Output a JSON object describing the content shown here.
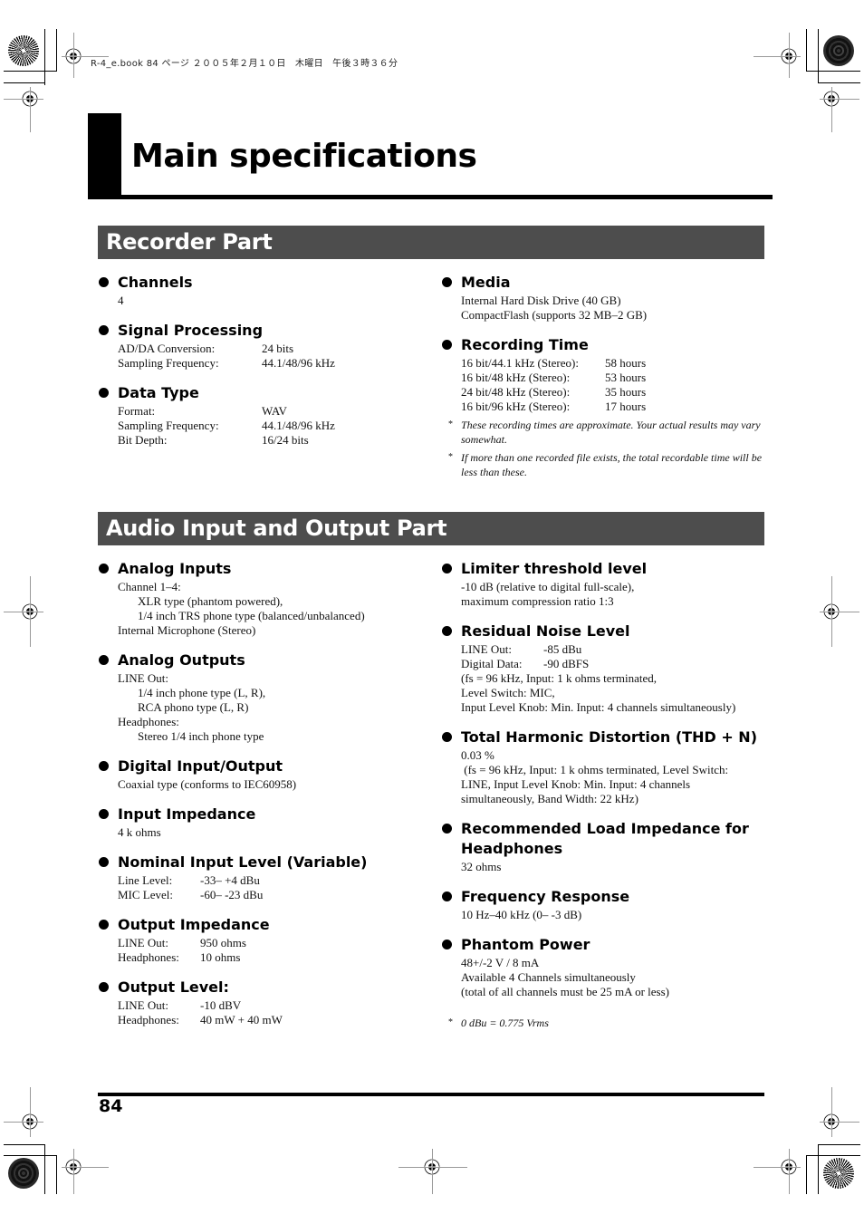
{
  "book_header": "R-4_e.book  84 ページ  ２００５年２月１０日　木曜日　午後３時３６分",
  "page_title": "Main specifications",
  "sections": {
    "recorder": {
      "title": "Recorder Part",
      "left": [
        {
          "heading": "Channels",
          "lines": [
            "4"
          ]
        },
        {
          "heading": "Signal Processing",
          "rows": [
            {
              "k": "AD/DA Conversion:",
              "v": "24 bits"
            },
            {
              "k": "Sampling Frequency:",
              "v": "44.1/48/96 kHz"
            }
          ]
        },
        {
          "heading": "Data Type",
          "rows": [
            {
              "k": "Format:",
              "v": "WAV"
            },
            {
              "k": "Sampling Frequency:",
              "v": "44.1/48/96 kHz"
            },
            {
              "k": "Bit Depth:",
              "v": "16/24 bits"
            }
          ]
        }
      ],
      "right": [
        {
          "heading": "Media",
          "lines": [
            "Internal Hard Disk Drive (40 GB)",
            "CompactFlash (supports 32 MB–2 GB)"
          ]
        },
        {
          "heading": "Recording Time",
          "rows": [
            {
              "k": "16 bit/44.1 kHz (Stereo):",
              "v": "58 hours"
            },
            {
              "k": "16 bit/48 kHz (Stereo):",
              "v": "53 hours"
            },
            {
              "k": "24 bit/48 kHz (Stereo):",
              "v": "35 hours"
            },
            {
              "k": "16 bit/96 kHz (Stereo):",
              "v": "17 hours"
            }
          ],
          "notes": [
            "These recording times are approximate. Your actual results may vary somewhat.",
            "If more than one recorded file exists, the total recordable time will be less than these."
          ]
        }
      ]
    },
    "audio": {
      "title": "Audio Input and Output Part",
      "left": [
        {
          "heading": "Analog Inputs",
          "lines": [
            "Channel 1–4:",
            ">XLR type (phantom powered),",
            ">1/4 inch TRS phone type (balanced/unbalanced)",
            "Internal Microphone (Stereo)"
          ]
        },
        {
          "heading": "Analog Outputs",
          "lines": [
            "LINE Out:",
            ">1/4 inch phone type (L, R),",
            ">RCA phono type (L, R)",
            "Headphones:",
            ">Stereo 1/4 inch phone type"
          ]
        },
        {
          "heading": "Digital Input/Output",
          "lines": [
            "Coaxial type (conforms to IEC60958)"
          ]
        },
        {
          "heading": "Input Impedance",
          "lines": [
            "4 k ohms"
          ]
        },
        {
          "heading": "Nominal Input Level (Variable)",
          "rows": [
            {
              "k": "Line Level:",
              "v": "-33– +4 dBu"
            },
            {
              "k": "MIC Level:",
              "v": "-60– -23 dBu"
            }
          ]
        },
        {
          "heading": "Output Impedance",
          "rows": [
            {
              "k": "LINE Out:",
              "v": "950 ohms"
            },
            {
              "k": "Headphones:",
              "v": "10 ohms"
            }
          ]
        },
        {
          "heading": "Output Level:",
          "rows": [
            {
              "k": "LINE Out:",
              "v": "-10 dBV"
            },
            {
              "k": "Headphones:",
              "v": "40 mW + 40 mW"
            }
          ]
        }
      ],
      "right": [
        {
          "heading": "Limiter threshold level",
          "lines": [
            "-10 dB (relative to digital full-scale),",
            "maximum compression ratio 1:3"
          ]
        },
        {
          "heading": "Residual Noise Level",
          "rows": [
            {
              "k": "LINE Out:",
              "v": "-85 dBu"
            },
            {
              "k": "Digital Data:",
              "v": "-90 dBFS"
            }
          ],
          "lines": [
            "(fs = 96 kHz, Input: 1 k ohms terminated,",
            "Level Switch: MIC,",
            "Input Level Knob: Min. Input: 4 channels simultaneously)"
          ]
        },
        {
          "heading": "Total Harmonic Distortion (THD + N)",
          "lines": [
            "0.03 %",
            " (fs = 96 kHz, Input: 1 k ohms terminated, Level Switch:",
            "LINE, Input Level Knob: Min. Input: 4 channels",
            "simultaneously, Band Width: 22 kHz)"
          ]
        },
        {
          "heading": "Recommended Load Impedance for Headphones",
          "lines": [
            "32 ohms"
          ]
        },
        {
          "heading": "Frequency Response",
          "lines": [
            "10 Hz–40 kHz (0– -3 dB)"
          ]
        },
        {
          "heading": "Phantom Power",
          "lines": [
            "48+/-2 V / 8 mA",
            "Available 4 Channels simultaneously",
            "(total of all channels must be 25 mA or less)"
          ],
          "notes": [
            "0 dBu = 0.775 Vrms"
          ]
        }
      ]
    }
  },
  "page_number": "84"
}
